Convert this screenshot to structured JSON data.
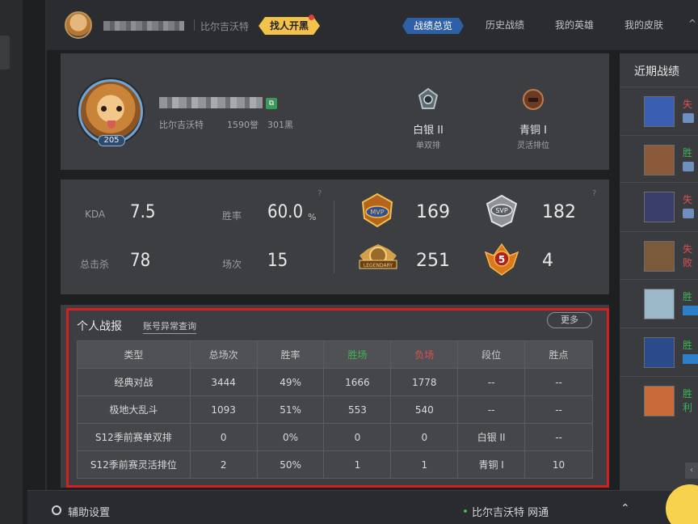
{
  "topbar": {
    "server": "比尔吉沃特",
    "find_button": "找人开黑",
    "tabs": [
      {
        "label": "战绩总览",
        "active": true
      },
      {
        "label": "历史战绩",
        "active": false
      },
      {
        "label": "我的英雄",
        "active": false
      },
      {
        "label": "我的皮肤",
        "active": false
      }
    ],
    "chevron": "^"
  },
  "profile": {
    "level": "205",
    "server": "比尔吉沃特",
    "honor": "1590誉",
    "black": "301黑",
    "ranks": [
      {
        "tier": "白银 II",
        "queue": "单双排",
        "color": "#9aa5ad"
      },
      {
        "tier": "青铜 I",
        "queue": "灵活排位",
        "color": "#a0603a"
      }
    ]
  },
  "stats": {
    "kda_label": "KDA",
    "kda_value": "7.5",
    "winrate_label": "胜率",
    "winrate_value": "60.0",
    "winrate_unit": "%",
    "kills_label": "总击杀",
    "kills_value": "78",
    "games_label": "场次",
    "games_value": "15",
    "question": "?",
    "badges": [
      {
        "name": "MVP",
        "count": "169"
      },
      {
        "name": "SVP",
        "count": "182"
      },
      {
        "name": "LEGENDARY",
        "count": "251"
      },
      {
        "name": "5",
        "count": "4"
      }
    ]
  },
  "report": {
    "title": "个人战报",
    "link": "账号异常查询",
    "more": "更多",
    "headers": [
      "类型",
      "总场次",
      "胜率",
      "胜场",
      "负场",
      "段位",
      "胜点"
    ],
    "rows": [
      [
        "经典对战",
        "3444",
        "49%",
        "1666",
        "1778",
        "--",
        "--"
      ],
      [
        "极地大乱斗",
        "1093",
        "51%",
        "553",
        "540",
        "--",
        "--"
      ],
      [
        "S12季前赛单双排",
        "0",
        "0%",
        "0",
        "0",
        "白银 II",
        "--"
      ],
      [
        "S12季前赛灵活排位",
        "2",
        "50%",
        "1",
        "1",
        "青铜 I",
        "10"
      ]
    ]
  },
  "recent": {
    "title": "近期战绩",
    "items": [
      {
        "result": "失败",
        "type": "lose",
        "color": "#3a5fb0"
      },
      {
        "result": "胜利",
        "type": "win",
        "color": "#8a5a3a"
      },
      {
        "result": "失败",
        "type": "lose",
        "color": "#3a3f6a"
      },
      {
        "result": "失败",
        "type": "lose",
        "color": "#7a5a3a"
      },
      {
        "result": "胜利",
        "type": "win",
        "color": "#9ab8c8"
      },
      {
        "result": "胜利",
        "type": "win",
        "color": "#2a4a8a"
      },
      {
        "result": "胜利",
        "type": "win",
        "color": "#c86a3a"
      }
    ]
  },
  "bottombar": {
    "assist": "辅助设置",
    "network": "比尔吉沃特 网通"
  }
}
